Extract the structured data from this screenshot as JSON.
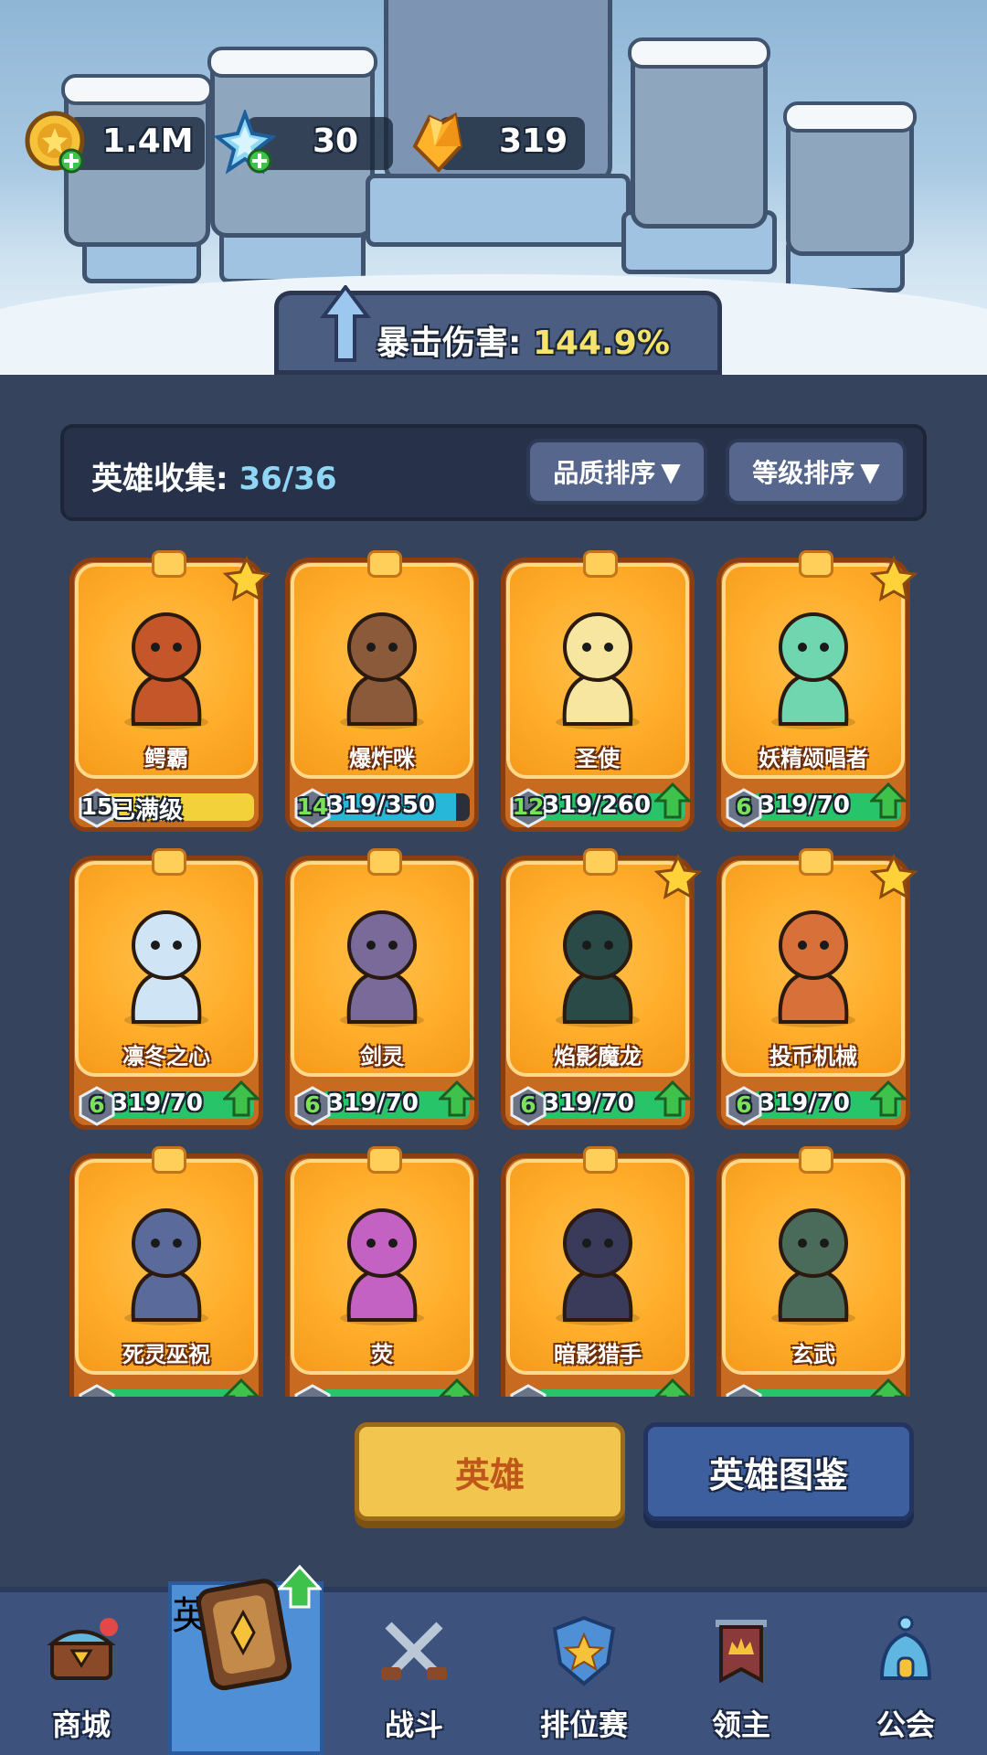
{
  "currencies": {
    "gold": "1.4M",
    "crystal": "30",
    "gem": "319"
  },
  "crit": {
    "label": "暴击伤害:",
    "value": "144.9%"
  },
  "collection": {
    "label": "英雄收集:",
    "count": "36/36",
    "sort_quality": "品质排序",
    "sort_level": "等级排序"
  },
  "heroes": [
    {
      "name": "鳄霸",
      "level": "15",
      "progress": "已满级",
      "starred": true,
      "fill": 1.0,
      "max": true
    },
    {
      "name": "爆炸咪",
      "level": "14",
      "progress": "319/350",
      "starred": false,
      "fill": 0.91,
      "max": false
    },
    {
      "name": "圣使",
      "level": "12",
      "progress": "319/260",
      "starred": false,
      "fill": 1.0,
      "upgrade": true
    },
    {
      "name": "妖精颂唱者",
      "level": "6",
      "progress": "319/70",
      "starred": true,
      "fill": 1.0,
      "upgrade": true
    },
    {
      "name": "凛冬之心",
      "level": "6",
      "progress": "319/70",
      "starred": false,
      "fill": 1.0,
      "upgrade": true
    },
    {
      "name": "剑灵",
      "level": "6",
      "progress": "319/70",
      "starred": false,
      "fill": 1.0,
      "upgrade": true
    },
    {
      "name": "焰影魔龙",
      "level": "6",
      "progress": "319/70",
      "starred": true,
      "fill": 1.0,
      "upgrade": true
    },
    {
      "name": "投币机械",
      "level": "6",
      "progress": "319/70",
      "starred": true,
      "fill": 1.0,
      "upgrade": true
    },
    {
      "name": "死灵巫祝",
      "level": "",
      "progress": "",
      "starred": false,
      "fill": 1.0,
      "upgrade": true
    },
    {
      "name": "荧",
      "level": "",
      "progress": "",
      "starred": false,
      "fill": 1.0,
      "upgrade": true
    },
    {
      "name": "暗影猎手",
      "level": "",
      "progress": "",
      "starred": false,
      "fill": 1.0,
      "upgrade": true
    },
    {
      "name": "玄武",
      "level": "",
      "progress": "",
      "starred": false,
      "fill": 1.0,
      "upgrade": true
    }
  ],
  "tabs": {
    "hero": "英雄",
    "atlas": "英雄图鉴"
  },
  "nav": {
    "shop": "商城",
    "hero": "英雄",
    "battle": "战斗",
    "ranked": "排位赛",
    "lord": "领主",
    "guild": "公会"
  },
  "colors": {
    "gold_text": "#f6e36b",
    "count_text": "#8fd6f4",
    "bar_green": "#27c46a",
    "bar_cyan": "#27b7d8",
    "bar_yellow": "#f2d13a",
    "card_orange": "#ffad2a"
  }
}
